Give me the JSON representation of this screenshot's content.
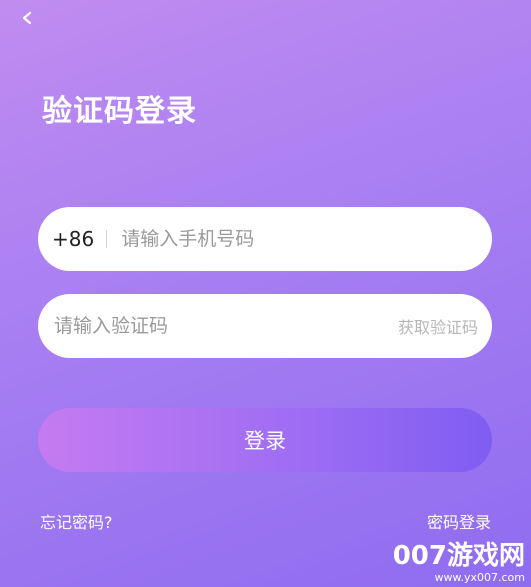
{
  "header": {
    "back_icon": "chevron-left-icon"
  },
  "title": "验证码登录",
  "phone_field": {
    "country_code": "+86",
    "placeholder": "请输入手机号码"
  },
  "code_field": {
    "placeholder": "请输入验证码",
    "get_code_label": "获取验证码"
  },
  "login_button": {
    "label": "登录"
  },
  "links": {
    "forgot_password": "忘记密码?",
    "password_login": "密码登录"
  },
  "watermark": {
    "logo": "007游戏网",
    "url": "www.yx007.com"
  }
}
